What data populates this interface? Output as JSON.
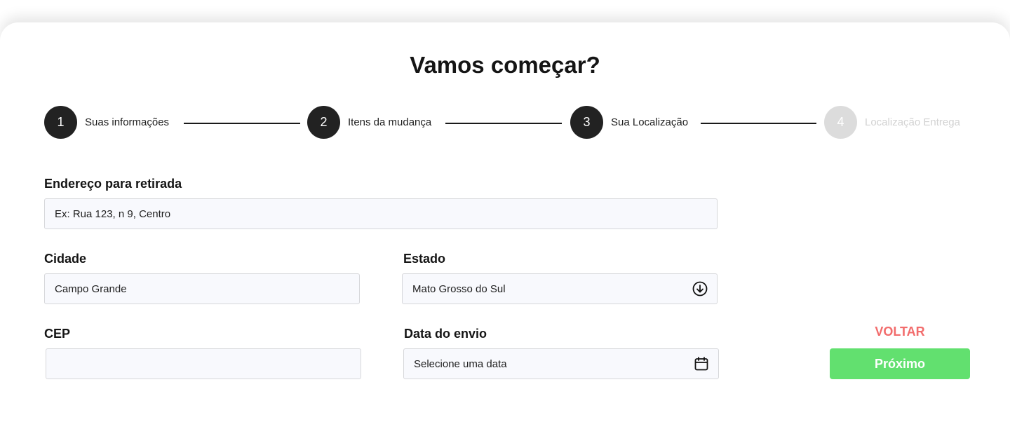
{
  "page": {
    "title": "Vamos começar?"
  },
  "stepper": {
    "steps": [
      {
        "number": "1",
        "label": "Suas informações",
        "active": true
      },
      {
        "number": "2",
        "label": "Itens da mudança",
        "active": true
      },
      {
        "number": "3",
        "label": "Sua Localização",
        "active": true
      },
      {
        "number": "4",
        "label": "Localização Entrega",
        "active": false
      }
    ]
  },
  "form": {
    "address": {
      "label": "Endereço para retirada",
      "value": "Ex: Rua 123, n 9, Centro"
    },
    "city": {
      "label": "Cidade",
      "value": "Campo Grande"
    },
    "state": {
      "label": "Estado",
      "value": "Mato Grosso do Sul",
      "icon": "arrow-down-circle-icon"
    },
    "cep": {
      "label": "CEP",
      "value": ""
    },
    "ship_date": {
      "label": "Data do envio",
      "value": "Selecione uma data",
      "icon": "calendar-icon"
    }
  },
  "actions": {
    "back_label": "VOLTAR",
    "next_label": "Próximo"
  },
  "colors": {
    "step_active": "#222222",
    "step_inactive": "#dcdcdc",
    "back": "#f26c6c",
    "next": "#62e06f",
    "field_bg": "#f8f9fd"
  }
}
